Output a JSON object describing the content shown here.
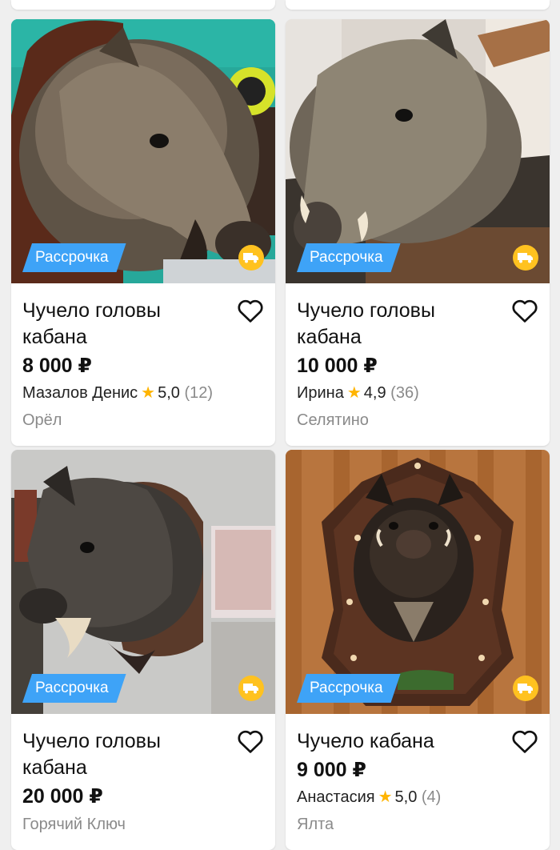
{
  "listings": [
    {
      "title": "Чучело головы кабана",
      "price": "8 000 ₽",
      "seller": "Мазалов Денис",
      "rating": "5,0",
      "reviews": "(12)",
      "city": "Орёл",
      "badge": "Рассрочка"
    },
    {
      "title": "Чучело головы кабана",
      "price": "10 000 ₽",
      "seller": "Ирина",
      "rating": "4,9",
      "reviews": "(36)",
      "city": "Селятино",
      "badge": "Рассрочка"
    },
    {
      "title": "Чучело головы кабана",
      "price": "20 000 ₽",
      "city": "Горячий Ключ",
      "badge": "Рассрочка"
    },
    {
      "title": "Чучело кабана",
      "price": "9 000 ₽",
      "seller": "Анастасия",
      "rating": "5,0",
      "reviews": "(4)",
      "city": "Ялта",
      "badge": "Рассрочка"
    }
  ],
  "icons": {
    "favorite": "heart-outline-icon",
    "delivery": "truck-icon",
    "rating": "star-icon"
  },
  "colors": {
    "badge": "#3ea3f7",
    "delivery": "#ffc220",
    "star": "#ffb400"
  }
}
